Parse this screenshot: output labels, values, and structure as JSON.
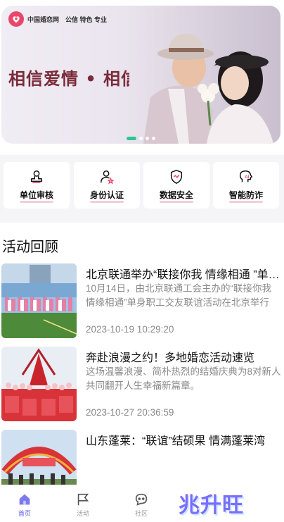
{
  "banner": {
    "logo_name": "中国婚恋网",
    "logo_tagline": "公信 特色 专业",
    "slogan": "相信爱情 • 相信我们",
    "slides": 4,
    "active_slide": 1
  },
  "features": [
    {
      "label": "单位审核",
      "icon": "user-stamp-icon"
    },
    {
      "label": "身份认证",
      "icon": "user-verify-icon"
    },
    {
      "label": "数据安全",
      "icon": "shield-icon"
    },
    {
      "label": "智能防诈",
      "icon": "ai-head-icon"
    }
  ],
  "section": {
    "title": "活动回顾"
  },
  "activities": [
    {
      "title": "北京联通举办“联接你我 情缘相通 ”单身职工交友联谊活动",
      "desc": "10月14日，由北京联通工会主办的“联接你我 情缘相通”单身职工交友联谊活动在北京举行",
      "date": "2023-10-19 10:29:20"
    },
    {
      "title": "奔赴浪漫之约！多地婚恋活动速览",
      "desc": "这场温馨浪漫、简朴热烈的结婚庆典为8对新人共同翻开人生幸福新篇章。",
      "date": "2023-10-27 20:36:59"
    },
    {
      "title": "山东蓬莱：“联谊”结硕果 情满蓬莱湾",
      "desc": "",
      "date": ""
    }
  ],
  "tabbar": {
    "items": [
      {
        "label": "首页",
        "icon": "home-icon"
      },
      {
        "label": "活动",
        "icon": "flag-icon"
      },
      {
        "label": "社区",
        "icon": "chat-icon"
      }
    ],
    "active": "首页"
  },
  "watermark": "兆升旺",
  "colors": {
    "accent": "#5b58e8",
    "brand_pink": "#e8466b",
    "slide_active": "#19c28a"
  }
}
